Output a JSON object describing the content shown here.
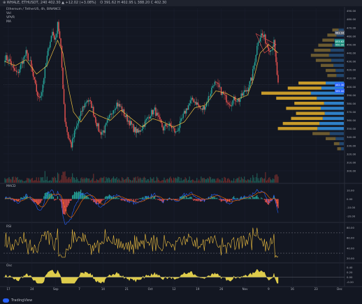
{
  "header": {
    "symbol_text": "⊕ WHALE, ETHUSDT, 240  402.30 ▲ +12.02 (+3.08%)",
    "ohlc_text": "O 391.62  H 402.95  L 388.20  C 402.30"
  },
  "legend": {
    "title": "Ethereum / TetherUS, 4h, BINANCE",
    "lines": [
      "Vol",
      "VPVR",
      "MA"
    ]
  },
  "pane_labels": {
    "macd": "MACD",
    "rsi": "RSI",
    "osc": "Osc"
  },
  "footer": {
    "brand": "TradingView"
  },
  "colors": {
    "background": "#131722",
    "up": "#26a69a",
    "down": "#ef5350",
    "ma": "#f0c040",
    "vp_volume": "#c89b2a",
    "vp_value_area": "#2f80c8",
    "vp_dim": "#6b5a30",
    "macd": "#2962ff",
    "signal": "#ff6d00",
    "rsi": "#f0c040",
    "osc": "#f5e050"
  },
  "chart_data": [
    {
      "type": "candlestick",
      "title": "Ethereum / TetherUS, 4h, BINANCE",
      "x_tick_labels": [
        "17",
        "24",
        "Sep",
        "7",
        "14",
        "21",
        "Oct",
        "12",
        "19",
        "26",
        "Nov",
        "9",
        "16",
        "23",
        "Dec"
      ],
      "y_tick_labels": [
        "490.00",
        "480.00",
        "470.00",
        "460.00",
        "450.00",
        "440.00",
        "430.00",
        "420.00",
        "410.00",
        "400.00",
        "390.00",
        "380.00",
        "370.00",
        "360.00",
        "350.00",
        "340.00",
        "330.00",
        "320.00",
        "310.00",
        "300.00"
      ],
      "ylim": [
        300,
        493
      ],
      "price_badges": [
        "463.94",
        "453.62",
        "450.00",
        "402.30",
        "395.00"
      ],
      "close_anchors": [
        [
          0,
          435
        ],
        [
          5,
          430
        ],
        [
          8,
          420
        ],
        [
          12,
          415
        ],
        [
          15,
          425
        ],
        [
          20,
          440
        ],
        [
          24,
          428
        ],
        [
          28,
          405
        ],
        [
          32,
          385
        ],
        [
          35,
          395
        ],
        [
          38,
          420
        ],
        [
          42,
          450
        ],
        [
          45,
          465
        ],
        [
          48,
          455
        ],
        [
          50,
          478
        ],
        [
          53,
          445
        ],
        [
          55,
          400
        ],
        [
          57,
          360
        ],
        [
          60,
          340
        ],
        [
          63,
          330
        ],
        [
          66,
          345
        ],
        [
          70,
          360
        ],
        [
          74,
          375
        ],
        [
          78,
          385
        ],
        [
          82,
          378
        ],
        [
          86,
          360
        ],
        [
          90,
          345
        ],
        [
          94,
          348
        ],
        [
          98,
          360
        ],
        [
          102,
          372
        ],
        [
          106,
          380
        ],
        [
          110,
          375
        ],
        [
          114,
          365
        ],
        [
          118,
          358
        ],
        [
          122,
          350
        ],
        [
          126,
          345
        ],
        [
          130,
          352
        ],
        [
          134,
          360
        ],
        [
          138,
          368
        ],
        [
          142,
          372
        ],
        [
          146,
          360
        ],
        [
          150,
          350
        ],
        [
          154,
          355
        ],
        [
          158,
          352
        ],
        [
          162,
          345
        ],
        [
          166,
          355
        ],
        [
          170,
          368
        ],
        [
          174,
          378
        ],
        [
          178,
          385
        ],
        [
          182,
          380
        ],
        [
          186,
          372
        ],
        [
          190,
          378
        ],
        [
          194,
          390
        ],
        [
          198,
          405
        ],
        [
          202,
          400
        ],
        [
          206,
          392
        ],
        [
          210,
          385
        ],
        [
          214,
          380
        ],
        [
          218,
          386
        ],
        [
          222,
          384
        ],
        [
          226,
          392
        ],
        [
          230,
          398
        ],
        [
          234,
          410
        ],
        [
          238,
          440
        ],
        [
          240,
          455
        ],
        [
          243,
          462
        ],
        [
          246,
          458
        ],
        [
          249,
          448
        ],
        [
          252,
          444
        ],
        [
          255,
          452
        ],
        [
          259,
          402
        ]
      ],
      "ma_anchors": [
        [
          0,
          430
        ],
        [
          10,
          425
        ],
        [
          20,
          432
        ],
        [
          30,
          415
        ],
        [
          40,
          425
        ],
        [
          50,
          455
        ],
        [
          55,
          440
        ],
        [
          60,
          400
        ],
        [
          65,
          370
        ],
        [
          72,
          358
        ],
        [
          80,
          372
        ],
        [
          90,
          365
        ],
        [
          100,
          360
        ],
        [
          110,
          372
        ],
        [
          120,
          362
        ],
        [
          130,
          352
        ],
        [
          140,
          362
        ],
        [
          150,
          358
        ],
        [
          160,
          352
        ],
        [
          170,
          358
        ],
        [
          180,
          375
        ],
        [
          190,
          378
        ],
        [
          200,
          395
        ],
        [
          210,
          392
        ],
        [
          220,
          385
        ],
        [
          230,
          390
        ],
        [
          236,
          410
        ],
        [
          242,
          440
        ],
        [
          250,
          450
        ],
        [
          259,
          440
        ]
      ],
      "volume_profile": [
        {
          "price": 467,
          "total": 0.14,
          "value_area": false
        },
        {
          "price": 461,
          "total": 0.2,
          "value_area": false
        },
        {
          "price": 455,
          "total": 0.26,
          "value_area": false
        },
        {
          "price": 449,
          "total": 0.31,
          "value_area": false
        },
        {
          "price": 443,
          "total": 0.36,
          "value_area": false
        },
        {
          "price": 437,
          "total": 0.4,
          "value_area": false
        },
        {
          "price": 431,
          "total": 0.34,
          "value_area": false
        },
        {
          "price": 425,
          "total": 0.28,
          "value_area": false
        },
        {
          "price": 419,
          "total": 0.22,
          "value_area": false
        },
        {
          "price": 413,
          "total": 0.2,
          "value_area": false
        },
        {
          "price": 404,
          "total": 0.55,
          "value_area": true,
          "up_share": 0.4
        },
        {
          "price": 398,
          "total": 0.68,
          "value_area": true,
          "up_share": 0.4
        },
        {
          "price": 392,
          "total": 1.0,
          "value_area": true,
          "up_share": 0.4
        },
        {
          "price": 386,
          "total": 0.82,
          "value_area": true,
          "up_share": 0.4
        },
        {
          "price": 380,
          "total": 0.6,
          "value_area": true,
          "up_share": 0.4
        },
        {
          "price": 374,
          "total": 0.7,
          "value_area": true,
          "up_share": 0.4
        },
        {
          "price": 368,
          "total": 0.58,
          "value_area": true,
          "up_share": 0.4
        },
        {
          "price": 362,
          "total": 0.64,
          "value_area": true,
          "up_share": 0.4
        },
        {
          "price": 356,
          "total": 0.74,
          "value_area": true,
          "up_share": 0.4
        },
        {
          "price": 350,
          "total": 0.8,
          "value_area": true,
          "up_share": 0.4
        },
        {
          "price": 344,
          "total": 0.38,
          "value_area": false
        },
        {
          "price": 338,
          "total": 0.22,
          "value_area": false
        },
        {
          "price": 332,
          "total": 0.12,
          "value_area": false
        },
        {
          "price": 326,
          "total": 0.08,
          "value_area": false
        }
      ]
    },
    {
      "type": "line",
      "title": "MACD",
      "y_tick_labels": [
        "10.00",
        "0.00",
        "-10.00",
        "-20.00"
      ],
      "ylim": [
        -25,
        15
      ],
      "series": [
        {
          "name": "MACD"
        },
        {
          "name": "Signal"
        }
      ]
    },
    {
      "type": "line",
      "title": "RSI",
      "y_tick_labels": [
        "80.00",
        "60.00",
        "40.00",
        "20.00"
      ],
      "ylim": [
        15,
        85
      ],
      "bands": [
        70,
        30
      ],
      "series": [
        {
          "name": "RSI"
        }
      ]
    },
    {
      "type": "area",
      "title": "Osc",
      "y_tick_labels": [
        "0.40",
        "0.20",
        "0.00",
        "-0.20"
      ],
      "ylim": [
        -0.3,
        0.5
      ],
      "series": [
        {
          "name": "Osc"
        }
      ]
    }
  ]
}
